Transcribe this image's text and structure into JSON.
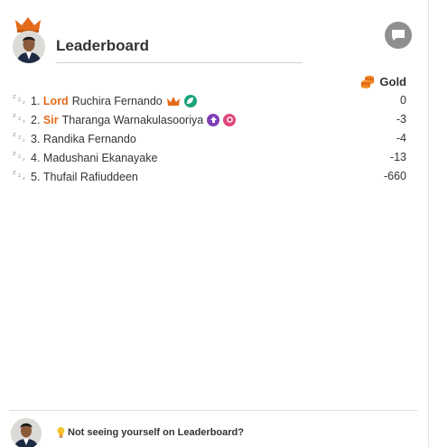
{
  "header": {
    "title": "Leaderboard",
    "avatar_alt": "user avatar",
    "crown_color": "#e36b1a"
  },
  "column": {
    "label": "Gold",
    "icon": "gold-coins-icon",
    "icon_color": "#e36b1a"
  },
  "rows": [
    {
      "rank": "1.",
      "title_tag": "Lord",
      "name": "Ruchira Fernando",
      "badges": [
        "crown-badge",
        "green-leaf-badge"
      ],
      "score": "0"
    },
    {
      "rank": "2.",
      "title_tag": "Sir",
      "name": "Tharanga Warnakulasooriya",
      "badges": [
        "purple-badge",
        "pink-badge"
      ],
      "score": "-3"
    },
    {
      "rank": "3.",
      "title_tag": "",
      "name": "Randika Fernando",
      "badges": [],
      "score": "-4"
    },
    {
      "rank": "4.",
      "title_tag": "",
      "name": "Madushani Ekanayake",
      "badges": [],
      "score": "-13"
    },
    {
      "rank": "5.",
      "title_tag": "",
      "name": "Thufail Rafiuddeen",
      "badges": [],
      "score": "-660"
    }
  ],
  "footer": {
    "message": "Not seeing yourself on Leaderboard?",
    "icon": "lightbulb-icon"
  },
  "colors": {
    "accent": "#e36b1a",
    "green_badge": "#1aa37a",
    "purple_badge": "#7e3fb8",
    "pink_badge": "#e0487a",
    "chat_button": "#8f8f8f"
  }
}
